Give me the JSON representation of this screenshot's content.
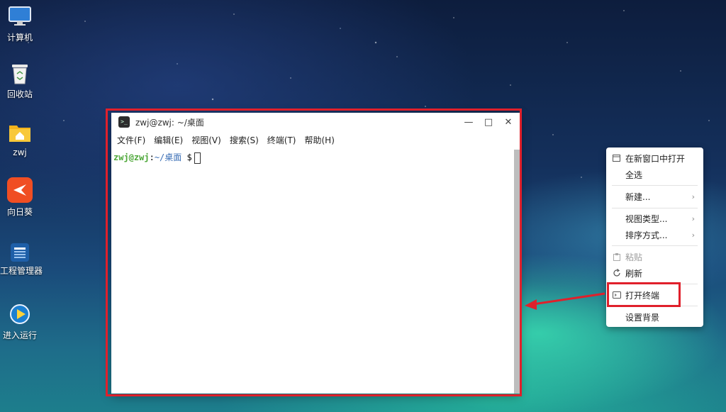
{
  "desktop": {
    "icons": [
      {
        "label": "计算机",
        "icon": "computer-icon"
      },
      {
        "label": "回收站",
        "icon": "trash-icon"
      },
      {
        "label": "zwj",
        "icon": "home-folder-icon"
      },
      {
        "label": "向日葵",
        "icon": "sunlogin-icon"
      },
      {
        "label": "工程管理器",
        "icon": "project-manager-icon"
      },
      {
        "label": "进入运行",
        "icon": "run-icon"
      }
    ]
  },
  "terminal": {
    "title": "zwj@zwj: ~/桌面",
    "menu": [
      "文件(F)",
      "编辑(E)",
      "视图(V)",
      "搜索(S)",
      "终端(T)",
      "帮助(H)"
    ],
    "prompt_user": "zwj@zwj",
    "prompt_sep": ":",
    "prompt_path": "~/桌面",
    "prompt_symbol": " $",
    "window_buttons": [
      "—",
      "□",
      "✕"
    ]
  },
  "context_menu": {
    "items": [
      {
        "label": "在新窗口中打开",
        "icon": "new-window-icon"
      },
      {
        "label": "全选"
      },
      {
        "label": "新建...",
        "submenu": true
      },
      {
        "label": "视图类型...",
        "submenu": true
      },
      {
        "label": "排序方式...",
        "submenu": true
      },
      {
        "label": "粘贴",
        "icon": "paste-icon",
        "disabled": true
      },
      {
        "label": "刷新",
        "icon": "refresh-icon"
      },
      {
        "label": "打开终端",
        "icon": "terminal-icon",
        "highlighted": true
      },
      {
        "label": "设置背景"
      }
    ]
  },
  "colors": {
    "highlight": "#e0202b",
    "prompt_user": "#4ea83a",
    "prompt_path": "#3b6fb6"
  }
}
